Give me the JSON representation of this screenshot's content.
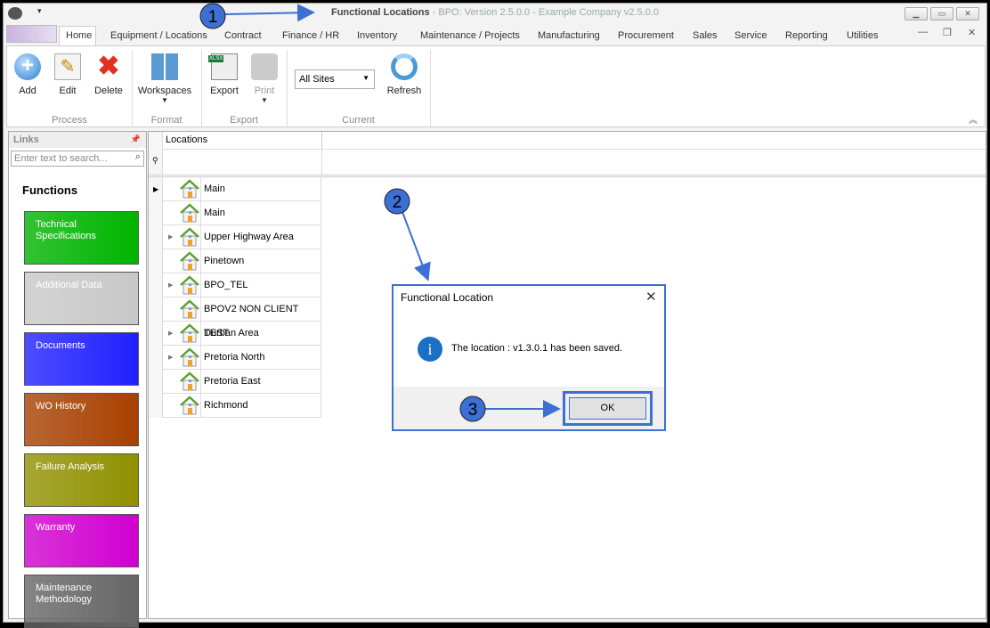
{
  "window": {
    "title_main": "Functional Locations",
    "title_rest": " - BPO: Version 2.5.0.0 - Example Company v2.5.0.0"
  },
  "tabs": [
    "Home",
    "Equipment / Locations",
    "Contract",
    "Finance / HR",
    "Inventory",
    "Maintenance / Projects",
    "Manufacturing",
    "Procurement",
    "Sales",
    "Service",
    "Reporting",
    "Utilities"
  ],
  "ribbon": {
    "add": "Add",
    "edit": "Edit",
    "delete": "Delete",
    "workspaces": "Workspaces",
    "export": "Export",
    "print": "Print",
    "site_select": "All Sites",
    "refresh": "Refresh",
    "groups": {
      "process": "Process",
      "format": "Format",
      "export": "Export",
      "current": "Current"
    }
  },
  "sidebar": {
    "title": "Links",
    "search_placeholder": "Enter text to search...",
    "functions_heading": "Functions",
    "tiles": [
      {
        "label": "Technical Specifications",
        "color": "#00b400"
      },
      {
        "label": "Additional Data",
        "color": "#c8c8c8"
      },
      {
        "label": "Documents",
        "color": "#2020ff"
      },
      {
        "label": "WO History",
        "color": "#a84000"
      },
      {
        "label": "Failure Analysis",
        "color": "#909000"
      },
      {
        "label": "Warranty",
        "color": "#d000d0"
      },
      {
        "label": "Maintenance Methodology",
        "color": "#666666"
      }
    ]
  },
  "grid": {
    "column": "Locations",
    "rows": [
      {
        "label": "Main",
        "expandable": false,
        "current": true
      },
      {
        "label": "Main",
        "expandable": false
      },
      {
        "label": "Upper Highway Area",
        "expandable": true
      },
      {
        "label": "Pinetown",
        "expandable": false
      },
      {
        "label": "BPO_TEL",
        "expandable": true
      },
      {
        "label": "BPOV2 NON CLIENT TEST",
        "expandable": false
      },
      {
        "label": "Durban Area",
        "expandable": true
      },
      {
        "label": "Pretoria North",
        "expandable": true
      },
      {
        "label": "Pretoria East",
        "expandable": false
      },
      {
        "label": "Richmond",
        "expandable": false
      }
    ]
  },
  "dialog": {
    "title": "Functional Location",
    "message": "The location : v1.3.0.1 has been saved.",
    "ok": "OK",
    "icon": "info-icon"
  },
  "annotations": [
    "1",
    "2",
    "3"
  ],
  "colors": {
    "annotation": "#3d6fd4"
  }
}
